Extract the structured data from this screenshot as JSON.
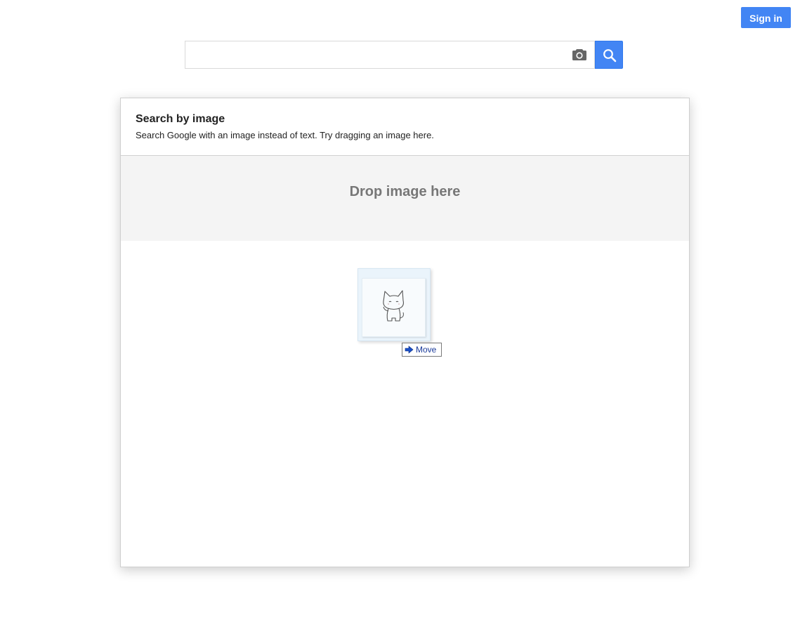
{
  "header": {
    "sign_in_label": "Sign in"
  },
  "search": {
    "value": "",
    "placeholder": "",
    "camera_icon": "camera-icon",
    "search_icon": "search-icon"
  },
  "dialog": {
    "title": "Search by image",
    "subtitle": "Search Google with an image instead of text. Try dragging an image here.",
    "drop_text": "Drop image here"
  },
  "drag": {
    "image_icon": "cat-image",
    "tooltip_icon": "arrow-right-icon",
    "tooltip_label": "Move"
  },
  "colors": {
    "accent": "#4285f4",
    "drop_zone_bg": "#f4f4f4",
    "drop_text": "#777777",
    "tooltip_text": "#1a3a9a"
  }
}
